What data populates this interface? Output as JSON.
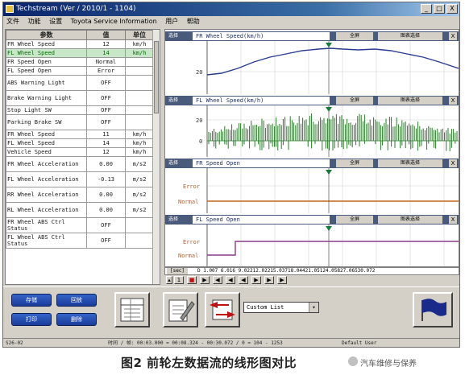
{
  "window": {
    "title": "Techstream (Ver / 2010/1 - 1104)",
    "controls": [
      "_",
      "□",
      "X"
    ]
  },
  "menu": [
    "文件",
    "功能",
    "设置",
    "Toyota Service Information",
    "用户",
    "帮助"
  ],
  "table": {
    "headers": [
      "参数",
      "值",
      "单位"
    ],
    "rows": [
      {
        "name": "FR Wheel Speed",
        "value": "12",
        "unit": "km/h"
      },
      {
        "name": "FL Wheel Speed",
        "value": "14",
        "unit": "km/h"
      },
      {
        "name": "FR Speed Open",
        "value": "Normal",
        "unit": ""
      },
      {
        "name": "FL Speed Open",
        "value": "Error",
        "unit": ""
      },
      {
        "name": "ABS Warning Light",
        "value": "OFF",
        "unit": ""
      },
      {
        "name": "Brake Warning Light",
        "value": "OFF",
        "unit": ""
      },
      {
        "name": "Stop Light SW",
        "value": "OFF",
        "unit": ""
      },
      {
        "name": "Parking Brake SW",
        "value": "OFF",
        "unit": ""
      },
      {
        "name": "FR Wheel Speed",
        "value": "11",
        "unit": "km/h"
      },
      {
        "name": "FL Wheel Speed",
        "value": "14",
        "unit": "km/h"
      },
      {
        "name": "Vehicle Speed",
        "value": "12",
        "unit": "km/h"
      },
      {
        "name": "FR Wheel Acceleration",
        "value": "0.00",
        "unit": "m/s2"
      },
      {
        "name": "FL Wheel Acceleration",
        "value": "-0.13",
        "unit": "m/s2"
      },
      {
        "name": "RR Wheel Acceleration",
        "value": "0.00",
        "unit": "m/s2"
      },
      {
        "name": "RL Wheel Acceleration",
        "value": "0.00",
        "unit": "m/s2"
      },
      {
        "name": "FR Wheel ABS Ctrl Status",
        "value": "OFF",
        "unit": ""
      },
      {
        "name": "FL Wheel ABS Ctrl Status",
        "value": "OFF",
        "unit": ""
      }
    ]
  },
  "panels": [
    {
      "label": "选择",
      "title": "FR Wheel Speed(km/h)",
      "btn1": "全屏",
      "btn2": "图表选择",
      "close": "X",
      "ylabel": "20"
    },
    {
      "label": "选择",
      "title": "FL Wheel Speed(km/h)",
      "btn1": "全屏",
      "btn2": "图表选择",
      "close": "X",
      "ylabel_top": "20",
      "ylabel_bottom": "0"
    },
    {
      "label": "选择",
      "title": "FR Speed Open",
      "btn1": "全屏",
      "btn2": "图表选择",
      "close": "X",
      "ylabel_top": "Error",
      "ylabel_bottom": "Normal"
    },
    {
      "label": "选择",
      "title": "FL Speed Open",
      "btn1": "全屏",
      "btn2": "图表选择",
      "close": "X",
      "ylabel_top": "Error",
      "ylabel_bottom": "Normal"
    }
  ],
  "timeline": {
    "unit": "[sec]",
    "ticks": "D  1.007  6.016  9.02212.02215.03718.04421.05124.05827.06530.072"
  },
  "bottom": {
    "buttons": [
      "存储",
      "回放",
      "打印",
      "删除"
    ],
    "custom_list": "Custom List"
  },
  "status": {
    "left": "S26-02",
    "middle": "时间 / 帧: 00:03.000 = 00:08.324 - 00:30.072 / 0 = 104 - 1253",
    "right": "Default User"
  },
  "caption": {
    "text": "图2 前轮左数据流的线形图对比",
    "watermark": "汽车维修与保养"
  },
  "colors": {
    "navy_line": "#2a3c90",
    "green_fill": "#2a7a2a",
    "orange_line": "#c86414",
    "purple_line": "#8a3c8a",
    "marker": "#1a7a3a",
    "error_label": "#b0603a",
    "panel_header": "#4a5a7a"
  }
}
